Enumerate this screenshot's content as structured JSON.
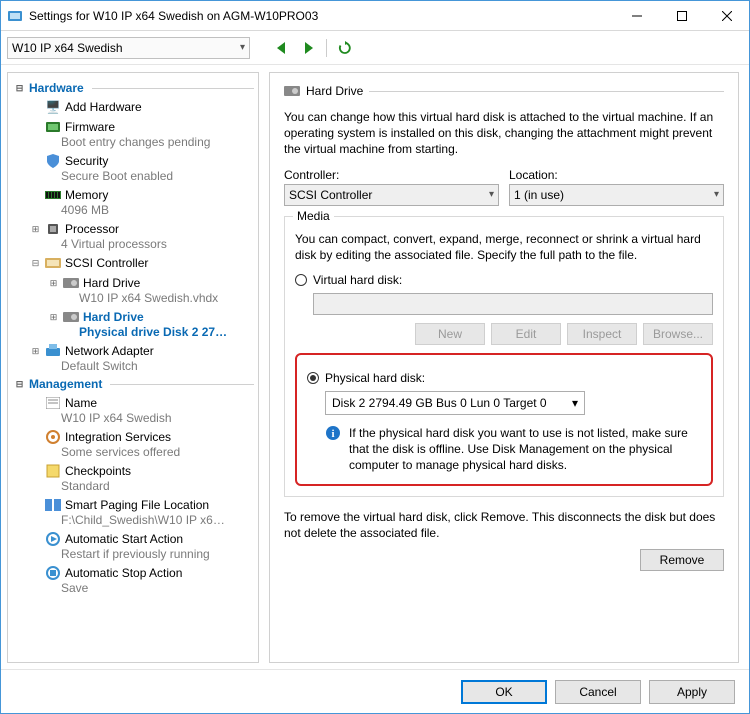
{
  "window": {
    "title": "Settings for W10 IP x64 Swedish on AGM-W10PRO03"
  },
  "toolbar": {
    "vm_selector": "W10 IP x64 Swedish"
  },
  "tree": {
    "hardware": "Hardware",
    "add_hw": "Add Hardware",
    "firmware": "Firmware",
    "firmware_sub": "Boot entry changes pending",
    "security": "Security",
    "security_sub": "Secure Boot enabled",
    "memory": "Memory",
    "memory_sub": "4096 MB",
    "processor": "Processor",
    "processor_sub": "4 Virtual processors",
    "scsi": "SCSI Controller",
    "hd1": "Hard Drive",
    "hd1_sub": "W10 IP x64 Swedish.vhdx",
    "hd2": "Hard Drive",
    "hd2_sub": "Physical drive Disk 2 2794....",
    "net": "Network Adapter",
    "net_sub": "Default Switch",
    "management": "Management",
    "name": "Name",
    "name_sub": "W10 IP x64 Swedish",
    "is": "Integration Services",
    "is_sub": "Some services offered",
    "ckpt": "Checkpoints",
    "ckpt_sub": "Standard",
    "spf": "Smart Paging File Location",
    "spf_sub": "F:\\Child_Swedish\\W10 IP x64 Swe...",
    "asa": "Automatic Start Action",
    "asa_sub": "Restart if previously running",
    "astop": "Automatic Stop Action",
    "astop_sub": "Save"
  },
  "right": {
    "title": "Hard Drive",
    "desc": "You can change how this virtual hard disk is attached to the virtual machine. If an operating system is installed on this disk, changing the attachment might prevent the virtual machine from starting.",
    "controller_label": "Controller:",
    "controller_value": "SCSI Controller",
    "location_label": "Location:",
    "location_value": "1 (in use)",
    "media_legend": "Media",
    "media_desc": "You can compact, convert, expand, merge, reconnect or shrink a virtual hard disk by editing the associated file. Specify the full path to the file.",
    "vhd_label": "Virtual hard disk:",
    "new": "New",
    "edit": "Edit",
    "inspect": "Inspect",
    "browse": "Browse...",
    "phd_label": "Physical hard disk:",
    "phd_value": "Disk 2 2794.49 GB Bus 0 Lun 0 Target 0",
    "phd_info": "If the physical hard disk you want to use is not listed, make sure that the disk is offline. Use Disk Management on the physical computer to manage physical hard disks.",
    "remove_cap": "To remove the virtual hard disk, click Remove. This disconnects the disk but does not delete the associated file.",
    "remove": "Remove"
  },
  "footer": {
    "ok": "OK",
    "cancel": "Cancel",
    "apply": "Apply"
  }
}
